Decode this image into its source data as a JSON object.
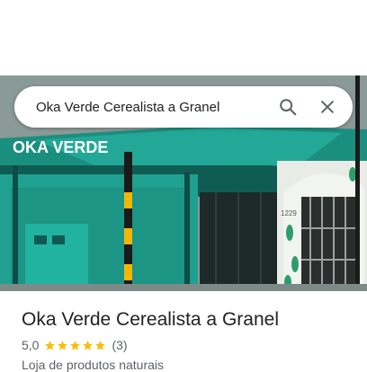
{
  "search": {
    "query": "Oka Verde Cerealista a Granel"
  },
  "photo": {
    "sign_text": "OKA VERDE",
    "house_number": "1229"
  },
  "place": {
    "title": "Oka Verde Cerealista a Granel",
    "rating": "5,0",
    "stars_filled": 5,
    "review_count": "(3)",
    "category": "Loja de produtos naturais"
  },
  "colors": {
    "star": "#fbbc04",
    "facade": "#1fa090",
    "icon": "#5f6368"
  }
}
